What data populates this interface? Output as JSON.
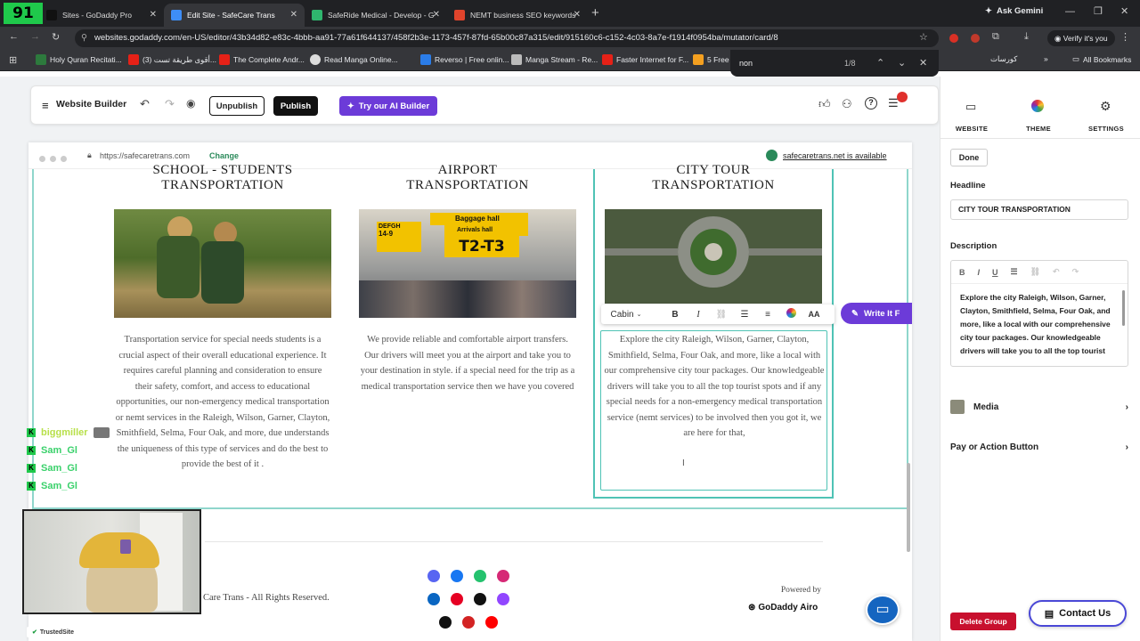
{
  "browser": {
    "tabs": [
      {
        "title": "Sites - GoDaddy Pro",
        "active": false
      },
      {
        "title": "Edit Site - SafeCare Trans",
        "active": true
      },
      {
        "title": "SafeRide Medical - Develop - G",
        "active": false
      },
      {
        "title": "NEMT business SEO keywords",
        "active": false
      }
    ],
    "ask_gemini": "Ask Gemini",
    "url": "websites.godaddy.com/en-US/editor/43b34d82-e83c-4bbb-aa91-77a61f644137/458f2b3e-1173-457f-87fd-65b00c87a315/edit/915160c6-c152-4c03-8a7e-f1914f0954ba/mutator/card/8",
    "verify_label": "Verify it's you",
    "bookmarks": [
      "Holy Quran Recitati...",
      "(3) أقوى طريقة تست...",
      "The Complete Andr...",
      "Read Manga Online...",
      "Reverso | Free onlin...",
      "Manga Stream - Re...",
      "Faster Internet for F...",
      "5 Free",
      "كورسات"
    ],
    "all_bookmarks": "All Bookmarks",
    "find": {
      "query": "non",
      "count": "1/8"
    }
  },
  "stream_logo": "91",
  "builder": {
    "title": "Website Builder",
    "unpublish": "Unpublish",
    "publish": "Publish",
    "ai_builder": "Try our AI Builder",
    "notification_count": ""
  },
  "preview": {
    "url": "https://safecaretrans.com",
    "change": "Change",
    "domain_available": "safecaretrans.net is available"
  },
  "cards": [
    {
      "title_line1": "SCHOOL - STUDENTS",
      "title_line2": "TRANSPORTATION",
      "description": "Transportation service for special needs students is a crucial aspect of their overall educational experience. It requires careful planning and consideration to ensure their safety, comfort, and access to educational opportunities, our  non-emergency  medical transportation or nemt services in the Raleigh, Wilson, Garner, Clayton, Smithfield, Selma, Four Oak, and more, due understands the uniqueness of this type of services and do the best to provide the best of it ."
    },
    {
      "title_line1": "AIRPORT",
      "title_line2": "TRANSPORTATION",
      "description": "We provide reliable and comfortable airport transfers. Our drivers will meet you at the airport and take you to your destination in style. if a special need for the trip as a medical transportation service then we have you covered"
    },
    {
      "title_line1": "CITY TOUR",
      "title_line2": "TRANSPORTATION",
      "description": "Explore the city Raleigh, Wilson, Garner, Clayton, Smithfield, Selma, Four Oak, and more, like a local with our comprehensive city tour packages. Our knowledgeable drivers will take you to all the top tourist spots and if any special needs for a  non-emergency  medical transportation service (nemt services) to be involved then you got it, we are here for that,"
    }
  ],
  "airport_sign": {
    "top": "Baggage hall",
    "mid": "Arrivals hall",
    "code": "T2-T3",
    "left": "DEFGH",
    "small": "14-9"
  },
  "rich_text_toolbar": {
    "font": "Cabin",
    "write_it": "Write It F"
  },
  "footer": {
    "copyright": "Care Trans - All Rights Reserved.",
    "powered_by": "Powered by",
    "brand": "GoDaddy Airo"
  },
  "panel": {
    "tabs": [
      "WEBSITE",
      "THEME",
      "SETTINGS"
    ],
    "done": "Done",
    "headline_label": "Headline",
    "headline_value": "CITY TOUR  TRANSPORTATION",
    "description_label": "Description",
    "description_value": "Explore the city Raleigh, Wilson, Garner, Clayton, Smithfield, Selma, Four Oak, and more, like a local with our comprehensive city tour packages. Our knowledgeable drivers will take you to all the top tourist",
    "media": "Media",
    "pay_action": "Pay or Action Button",
    "delete_group": "Delete Group",
    "contact_us": "Contact Us"
  },
  "chat": [
    {
      "user": "biggmiller",
      "color": "#b8e04a"
    },
    {
      "user": "Sam_Gl",
      "color": "#3ad16b"
    },
    {
      "user": "Sam_Gl",
      "color": "#3ad16b"
    },
    {
      "user": "Sam_Gl",
      "color": "#3ad16b"
    }
  ],
  "trusted_site": "TrustedSite",
  "colors": {
    "accent_teal": "#4fc3b5",
    "purple": "#6c3bd8",
    "delete_red": "#c8102e",
    "chrome_dark": "#202124"
  }
}
